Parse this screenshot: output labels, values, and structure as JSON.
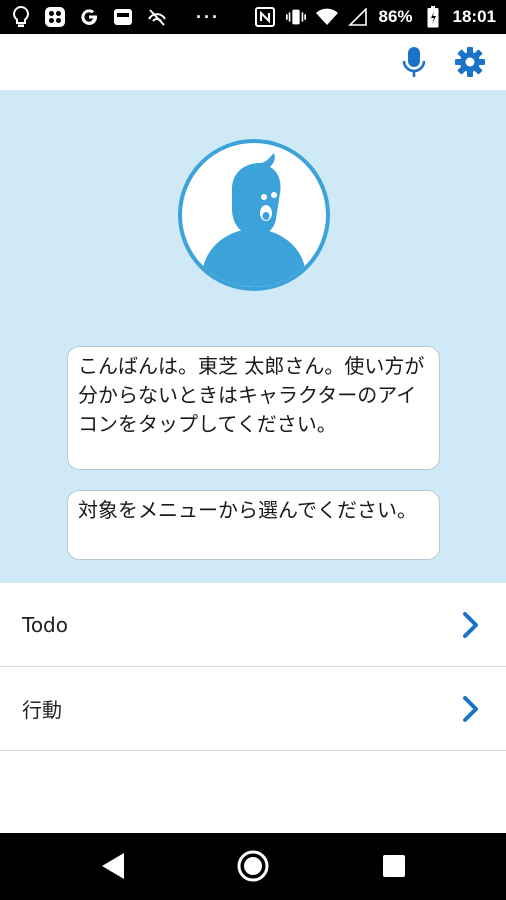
{
  "status_bar": {
    "icons_left": [
      "lightbulb-icon",
      "app-grid-icon",
      "google-icon",
      "app-icon",
      "no-sim-icon"
    ],
    "overflow": "···",
    "nfc": "N",
    "battery": "86%",
    "time": "18:01"
  },
  "app_bar": {
    "mic_icon": "microphone-icon",
    "settings_icon": "gear-icon",
    "accent_color": "#1a73c8"
  },
  "hero": {
    "background": "#cfeaf6",
    "avatar_color": "#3ba3d9",
    "messages": [
      "こんばんは。東芝 太郎さん。使い方が分からないときはキャラクターのアイコンをタップしてください。",
      "対象をメニューから選んでください。"
    ]
  },
  "menu": {
    "items": [
      {
        "label": "Todo"
      },
      {
        "label": "行動"
      }
    ]
  },
  "nav_bar": {
    "icons": [
      "back-icon",
      "home-icon",
      "recent-apps-icon"
    ]
  }
}
